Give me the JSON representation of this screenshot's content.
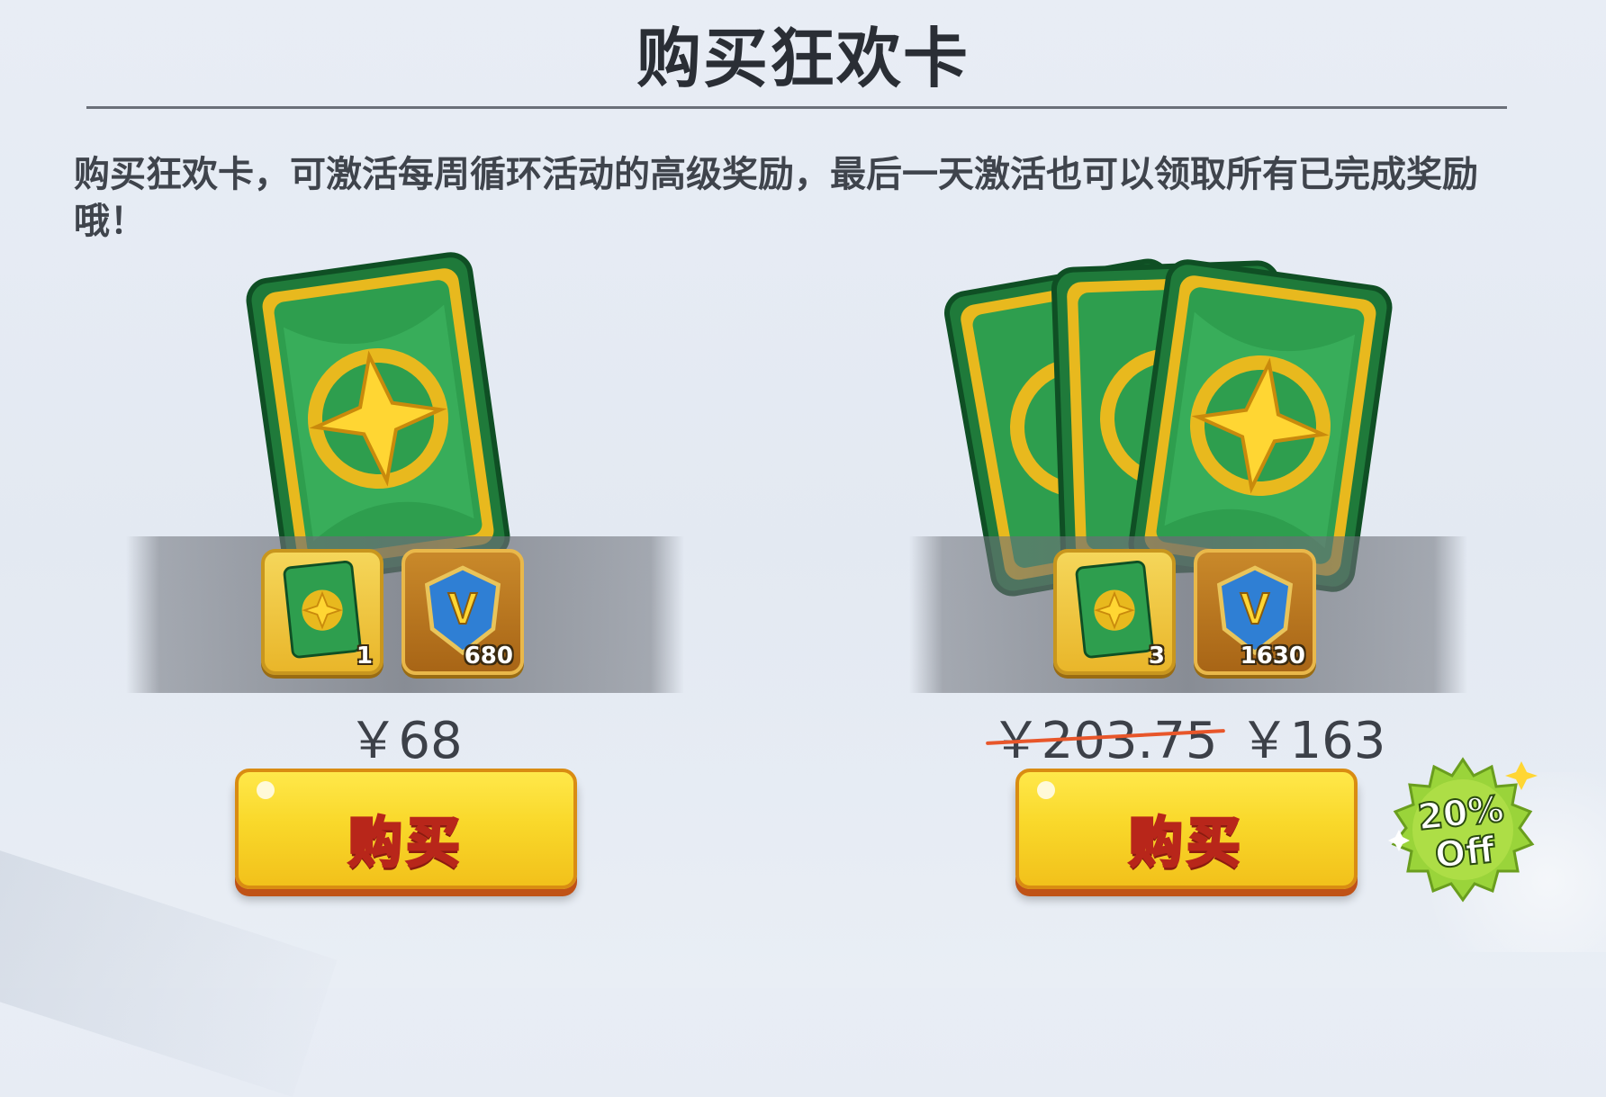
{
  "header": {
    "title": "购买狂欢卡"
  },
  "description": "购买狂欢卡，可激活每周循环活动的高级奖励，最后一天激活也可以领取所有已完成奖励哦！",
  "offers": [
    {
      "price": "￥68",
      "original_price": "",
      "items": [
        {
          "icon": "carnival-card-icon",
          "count": "1"
        },
        {
          "icon": "vip-badge-icon",
          "count": "680"
        }
      ],
      "button_label": "购买"
    },
    {
      "price": "￥163",
      "original_price": "￥203.75",
      "items": [
        {
          "icon": "carnival-card-icon",
          "count": "3"
        },
        {
          "icon": "vip-badge-icon",
          "count": "1630"
        }
      ],
      "button_label": "购买"
    }
  ],
  "discount_badge": {
    "line1": "20%",
    "line2": "Off"
  },
  "colors": {
    "button_yellow": "#f9d82a",
    "button_text_stroke": "#b8261a",
    "strike_line": "#e8562a",
    "card_green": "#2e9e4e",
    "card_gold": "#e8b91e",
    "badge_green": "#9ad43a"
  }
}
